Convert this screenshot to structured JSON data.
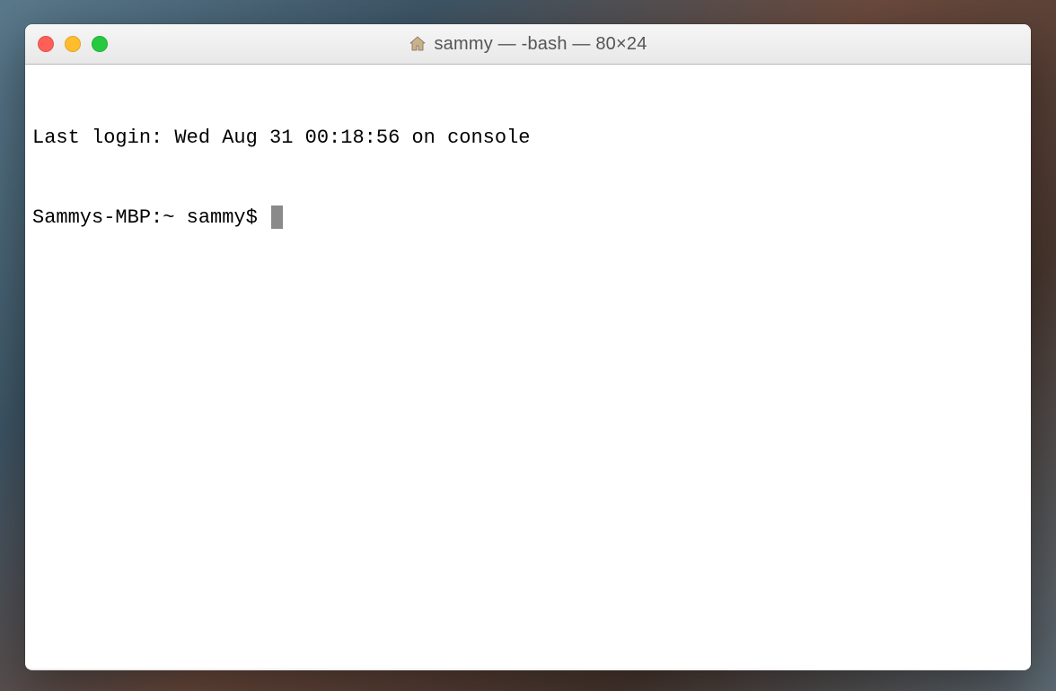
{
  "window": {
    "title": "sammy — -bash — 80×24"
  },
  "terminal": {
    "last_login": "Last login: Wed Aug 31 00:18:56 on console",
    "prompt": "Sammys-MBP:~ sammy$ "
  }
}
